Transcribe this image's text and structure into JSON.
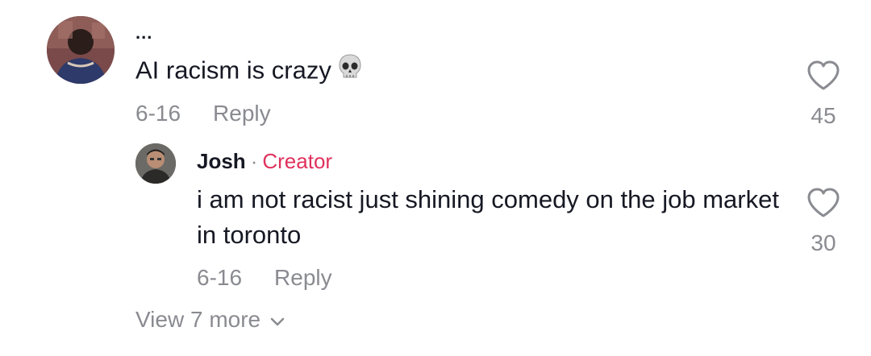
{
  "comment": {
    "username": "...",
    "text": "AI racism is crazy",
    "emoji": "skull-emoji",
    "date": "6-16",
    "reply_label": "Reply",
    "likes": "45"
  },
  "reply": {
    "username": "Josh",
    "separator": "·",
    "badge": "Creator",
    "text": "i am not racist just shining comedy on the job market in toronto",
    "date": "6-16",
    "reply_label": "Reply",
    "likes": "30"
  },
  "view_more": {
    "label": "View 7 more"
  },
  "colors": {
    "text_primary": "#161823",
    "text_secondary": "#8a8b91",
    "creator_accent": "#e0315c"
  }
}
